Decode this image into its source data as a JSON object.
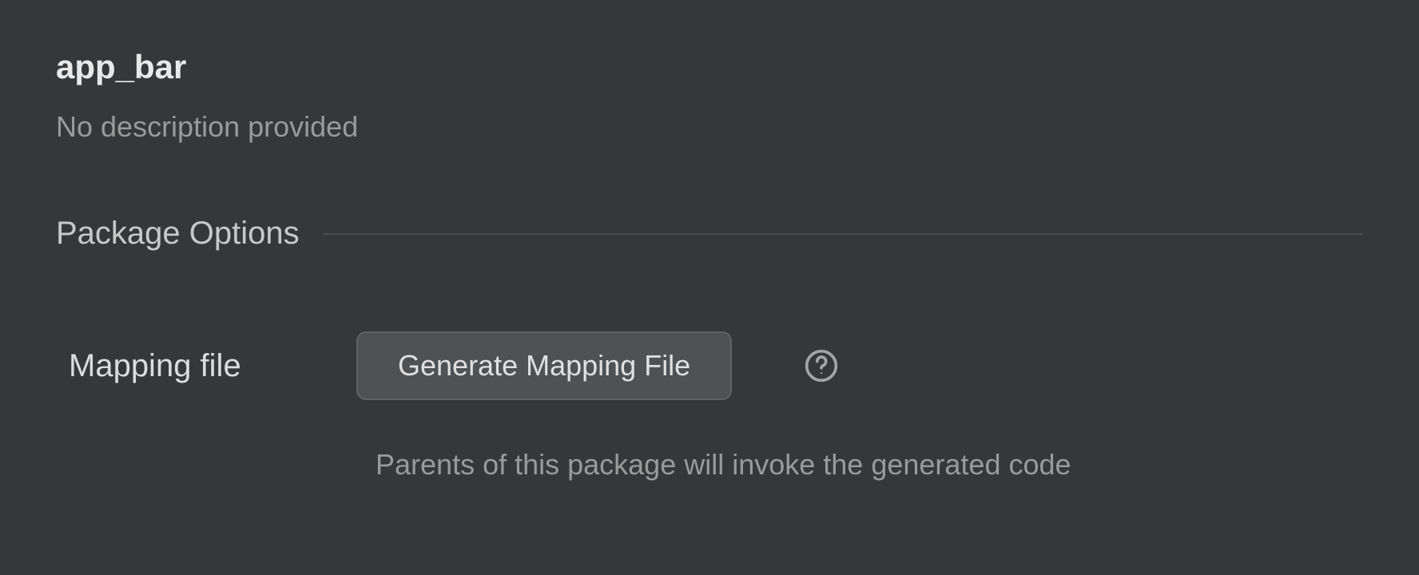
{
  "header": {
    "title": "app_bar",
    "description": "No description provided"
  },
  "section": {
    "title": "Package Options"
  },
  "options": {
    "mapping_file": {
      "label": "Mapping file",
      "button_label": "Generate Mapping File",
      "hint": "Parents of this package will invoke the generated code"
    }
  }
}
